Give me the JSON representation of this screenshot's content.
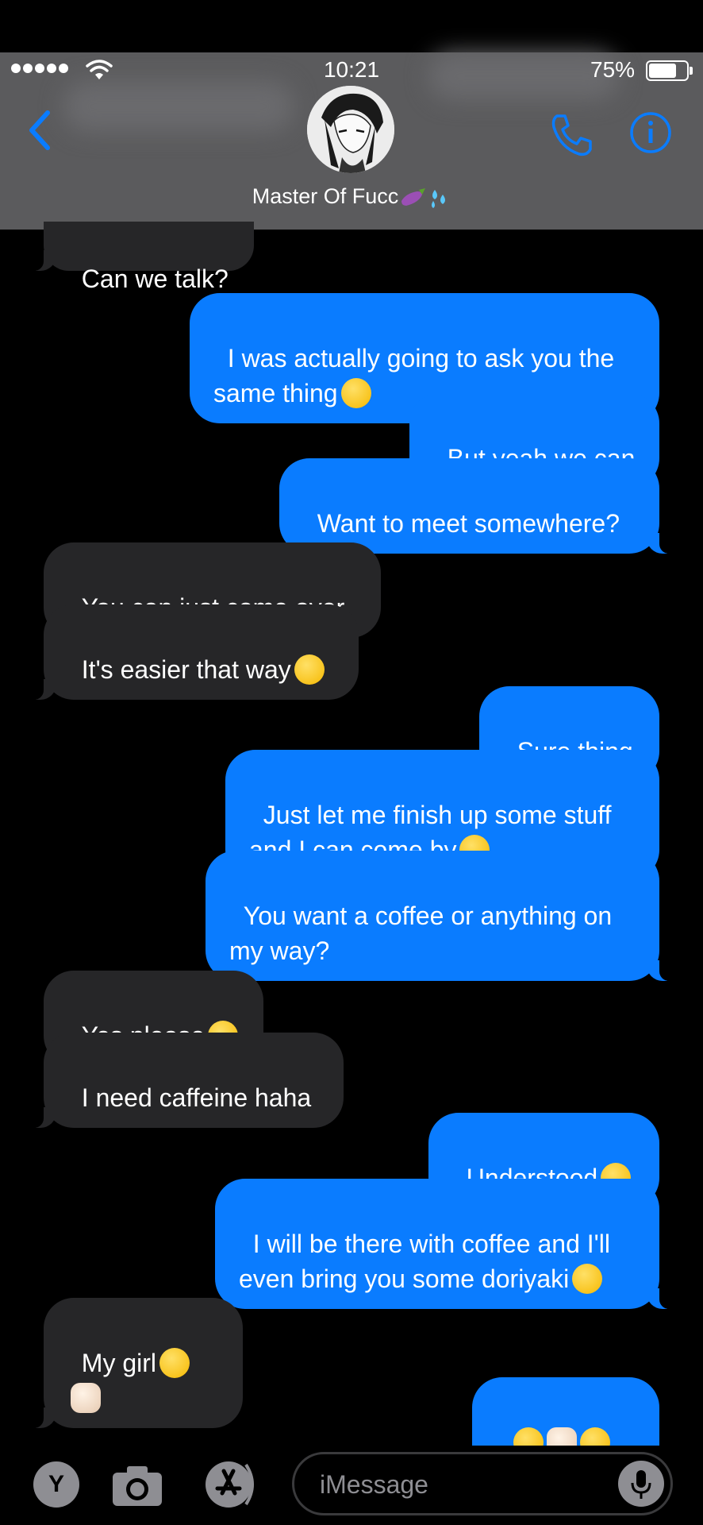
{
  "status_bar": {
    "time": "10:21",
    "battery_percent": "75%",
    "battery_level": 0.75
  },
  "header": {
    "contact_name": "Master Of Fucc",
    "contact_emoji": [
      "eggplant-emoji",
      "sweat-droplets-emoji"
    ],
    "back_icon": "chevron-left-icon",
    "call_icon": "phone-icon",
    "info_icon": "info-icon"
  },
  "messages": [
    {
      "side": "in",
      "text": "Can we talk?",
      "emoji": []
    },
    {
      "side": "out",
      "text": "I was actually going to ask you the same thing",
      "emoji": [
        "grinning-sweat-emoji"
      ]
    },
    {
      "side": "out",
      "text": "But yeah we can",
      "emoji": []
    },
    {
      "side": "out",
      "text": "Want to meet somewhere?",
      "emoji": []
    },
    {
      "side": "in",
      "text": "You can just come over",
      "emoji": []
    },
    {
      "side": "in",
      "text": "It's easier that way",
      "emoji": [
        "smiling-face-emoji"
      ]
    },
    {
      "side": "out",
      "text": "Sure thing",
      "emoji": []
    },
    {
      "side": "out",
      "text": "Just let me finish up some stuff and I can come by",
      "emoji": [
        "relaxed-emoji"
      ]
    },
    {
      "side": "out",
      "text": "You want a coffee or anything on my way?",
      "emoji": []
    },
    {
      "side": "in",
      "text": "Yes please",
      "emoji": [
        "pleading-face-emoji"
      ]
    },
    {
      "side": "in",
      "text": "I need caffeine haha",
      "emoji": []
    },
    {
      "side": "out",
      "text": "Understood",
      "emoji": [
        "sunglasses-emoji"
      ]
    },
    {
      "side": "out",
      "text": "I will be there with coffee and I'll even bring you some doriyaki",
      "emoji": [
        "relieved-emoji"
      ]
    },
    {
      "side": "in",
      "text": "My girl",
      "emoji": [
        "weary-face-emoji",
        "fist-bump-emoji"
      ]
    },
    {
      "side": "out",
      "text": "",
      "emoji": [
        "sunglasses-emoji",
        "fist-bump-emoji",
        "kissing-heart-emoji",
        "kissing-heart-emoji"
      ]
    }
  ],
  "input_bar": {
    "placeholder": "iMessage",
    "app_button_label": "Y",
    "camera_icon": "camera-icon",
    "appstore_icon": "app-store-icon",
    "mic_icon": "microphone-icon"
  },
  "colors": {
    "outgoing": "#0a7cff",
    "incoming": "#262628",
    "header": "#5b5b5d",
    "accent": "#0a7cff"
  }
}
